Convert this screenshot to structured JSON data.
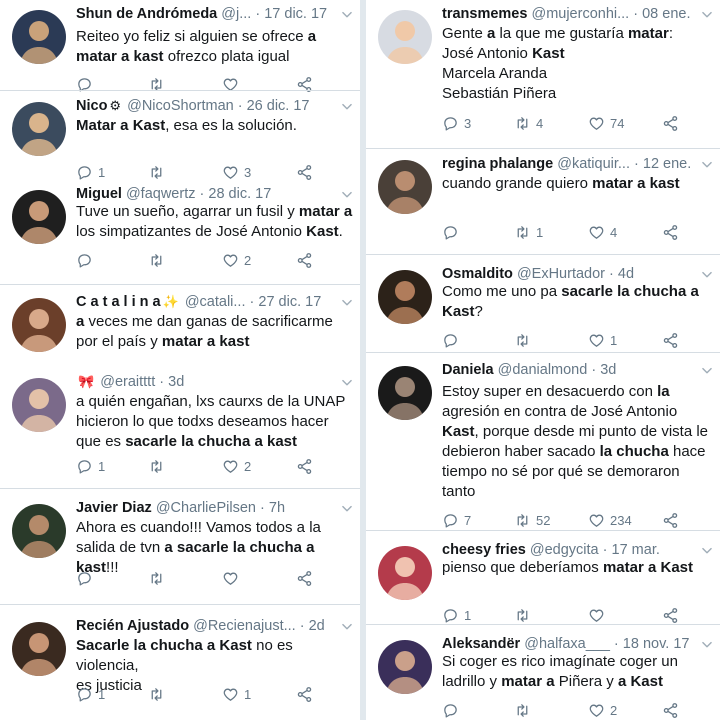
{
  "colors": {
    "accent": "#1da1f2",
    "text": "#14171a",
    "muted": "#657786",
    "divider": "#e1e8ed"
  },
  "left_tweets": [
    {
      "name": "Shun de Andrómeda",
      "handle": "@j...",
      "dot": "·",
      "date": "17 dic. 17",
      "body": [
        "Reiteo yo feliz si alguien se ofrece ",
        "a",
        "\n",
        "matar a kast",
        " ofrezco plata igual"
      ],
      "reply": "",
      "rt": "",
      "like": ""
    },
    {
      "name": "Nico",
      "emoji": "⚙",
      "handle": "@NicoShortman",
      "dot": "·",
      "date": "26 dic. 17",
      "body": [
        "Matar a Kast",
        ", esa es la solución."
      ],
      "reply": "1",
      "rt": "",
      "like": "3"
    },
    {
      "name": "Miguel",
      "handle": "@faqwertz",
      "dot": "·",
      "date": "28 dic. 17",
      "body": [
        "Tuve un sueño, agarrar un fusil y ",
        "matar a",
        "\n",
        "los simpatizantes de José Antonio ",
        "Kast",
        "."
      ],
      "reply": "",
      "rt": "",
      "like": "2"
    },
    {
      "name": "C a t a l i n a",
      "emoji": "✨",
      "handle": "@catali...",
      "dot": "·",
      "date": "27 dic. 17",
      "body": [
        "a",
        " veces me dan ganas de sacrificarme\npor el país y ",
        "matar a kast"
      ],
      "reply": "",
      "rt": "",
      "like": ""
    },
    {
      "name": "",
      "emoji": "🎀",
      "handle": "@eraitttt",
      "dot": "·",
      "date": "3d",
      "body": [
        "a quién engañan, lxs caurxs de la UNAP\nhicieron lo que todxs deseamos hacer\nque es ",
        "sacarle la chucha a kast"
      ],
      "reply": "1",
      "rt": "",
      "like": "2"
    },
    {
      "name": "Javier Diaz",
      "handle": "@CharliePilsen",
      "dot": "·",
      "date": "7h",
      "body": [
        "Ahora es cuando!!! Vamos todos a la\nsalida de tvn ",
        "a",
        " ",
        "sacarle la chucha a kast",
        "!!!"
      ],
      "reply": "",
      "rt": "",
      "like": ""
    },
    {
      "name": "Recién Ajustado",
      "handle": "@Recienajust...",
      "dot": "·",
      "date": "2d",
      "body": [
        "Sacarle la chucha a Kast",
        " no es violencia,\nes justicia"
      ],
      "reply": "1",
      "rt": "",
      "like": "1"
    }
  ],
  "right_tweets": [
    {
      "name": "transmemes",
      "handle": "@mujerconhi...",
      "dot": "·",
      "date": "08 ene.",
      "body": [
        "Gente ",
        "a",
        " la que me gustaría ",
        "matar",
        ":\nJosé Antonio ",
        "Kast",
        "\nMarcela Aranda\nSebastián Piñera"
      ],
      "reply": "3",
      "rt": "4",
      "like": "74"
    },
    {
      "name": "regina phalange",
      "handle": "@katiquir...",
      "dot": "·",
      "date": "12 ene.",
      "body": [
        "cuando grande quiero ",
        "matar a kast"
      ],
      "reply": "",
      "rt": "1",
      "like": "4"
    },
    {
      "name": "Osmaldito",
      "handle": "@ExHurtador",
      "dot": "·",
      "date": "4d",
      "body": [
        "Como me uno pa ",
        "sacarle la chucha a",
        "\n",
        "Kast",
        "?"
      ],
      "reply": "",
      "rt": "",
      "like": "1"
    },
    {
      "name": "Daniela",
      "handle": "@danialmond",
      "dot": "·",
      "date": "3d",
      "body": [
        "Estoy super en desacuerdo con ",
        "la",
        "\nagresión en contra de José Antonio\n",
        "Kast",
        ", porque desde mi punto de vista le\ndebieron haber sacado ",
        "la chucha",
        " hace\ntiempo no sé por qué se demoraron\ntanto"
      ],
      "reply": "7",
      "rt": "52",
      "like": "234"
    },
    {
      "name": "cheesy fries",
      "handle": "@edgycita",
      "dot": "·",
      "date": "17 mar.",
      "body": [
        "pienso que deberíamos ",
        "matar a Kast"
      ],
      "reply": "1",
      "rt": "",
      "like": ""
    },
    {
      "name": "Aleksandër",
      "handle": "@halfaxa___",
      "dot": "·",
      "date": "18 nov. 17",
      "body": [
        "Si coger es rico imagínate coger un\nladrillo y ",
        "matar a",
        " Piñera y ",
        "a Kast"
      ],
      "reply": "",
      "rt": "",
      "like": "2"
    }
  ]
}
